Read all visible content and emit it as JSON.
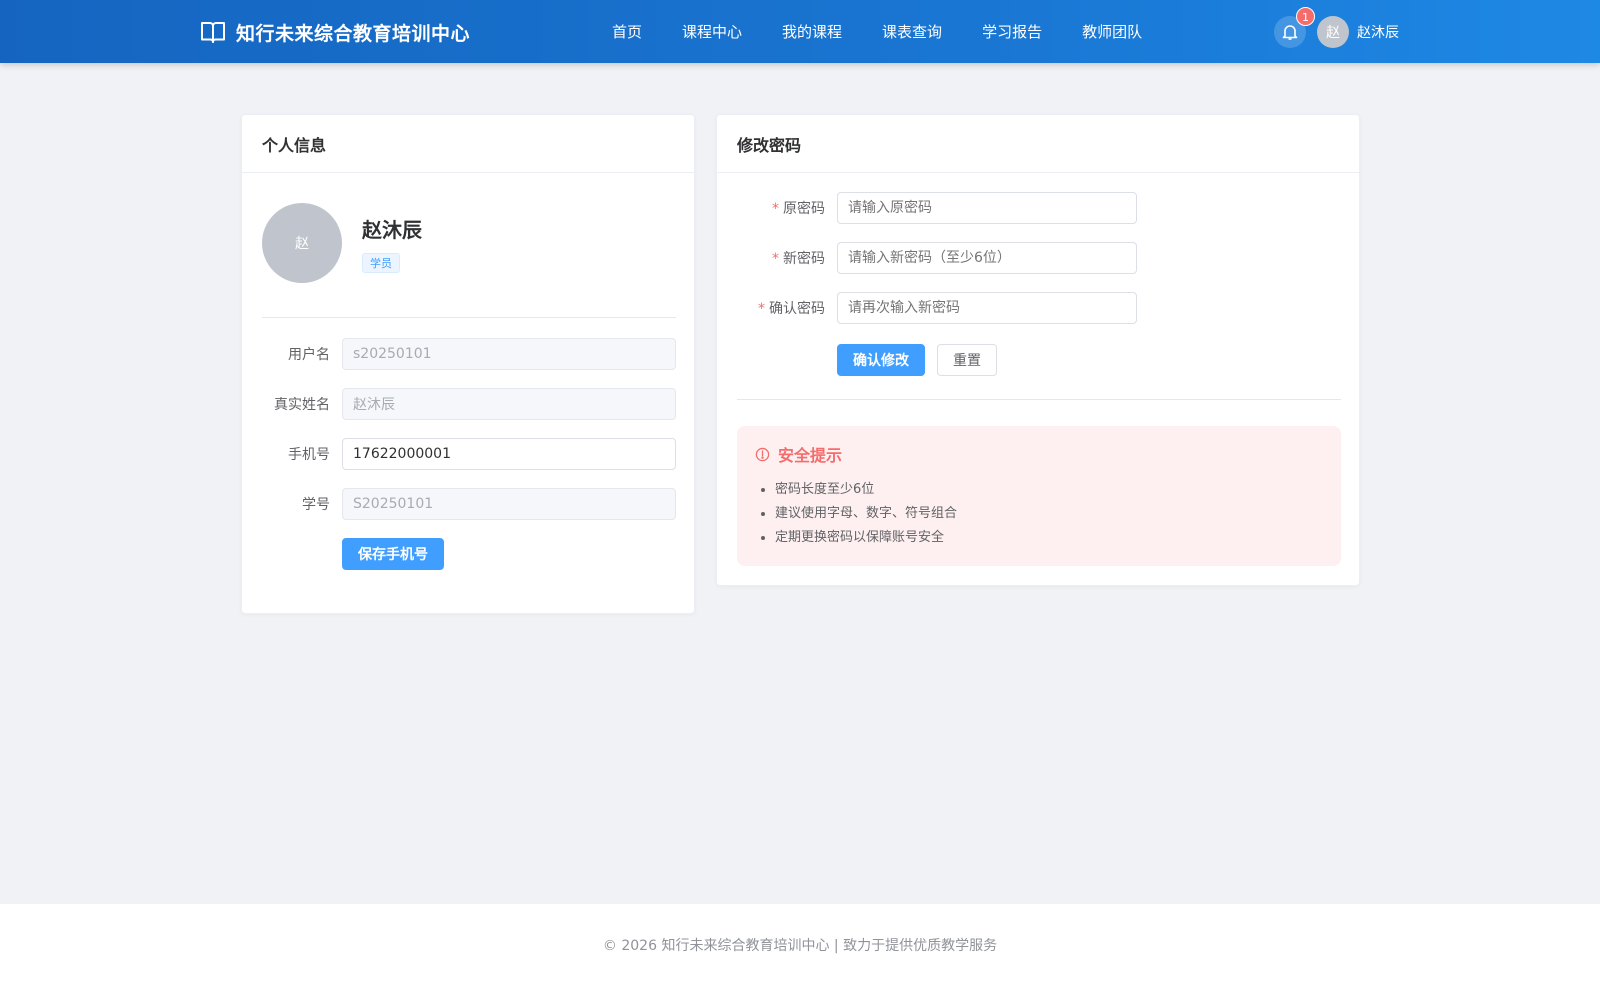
{
  "brand": {
    "title": "知行未来综合教育培训中心",
    "icon": "book-open-icon"
  },
  "nav": {
    "items": [
      "首页",
      "课程中心",
      "我的课程",
      "课表查询",
      "学习报告",
      "教师团队"
    ]
  },
  "header_user": {
    "notification_count": "1",
    "avatar_text": "赵",
    "name": "赵沐辰"
  },
  "profile_card": {
    "title": "个人信息",
    "avatar_text": "赵",
    "name": "赵沐辰",
    "role_tag": "学员",
    "fields": {
      "username": {
        "label": "用户名",
        "value": "s20250101"
      },
      "real_name": {
        "label": "真实姓名",
        "value": "赵沐辰"
      },
      "phone": {
        "label": "手机号",
        "value": "17622000001"
      },
      "student_id": {
        "label": "学号",
        "value": "S20250101"
      }
    },
    "save_button": "保存手机号"
  },
  "password_card": {
    "title": "修改密码",
    "required_mark": "*",
    "fields": {
      "old": {
        "label": "原密码",
        "placeholder": "请输入原密码"
      },
      "new": {
        "label": "新密码",
        "placeholder": "请输入新密码（至少6位）"
      },
      "confirm": {
        "label": "确认密码",
        "placeholder": "请再次输入新密码"
      }
    },
    "confirm_button": "确认修改",
    "reset_button": "重置"
  },
  "security_tips": {
    "title": "安全提示",
    "icon": "warning-circle-icon",
    "items": [
      "密码长度至少6位",
      "建议使用字母、数字、符号组合",
      "定期更换密码以保障账号安全"
    ]
  },
  "footer": {
    "text": "© 2026 知行未来综合教育培训中心 | 致力于提供优质教学服务"
  },
  "colors": {
    "header": "#1976d2",
    "primary": "#409eff",
    "danger": "#f56c6c",
    "background": "#f0f2f5"
  }
}
